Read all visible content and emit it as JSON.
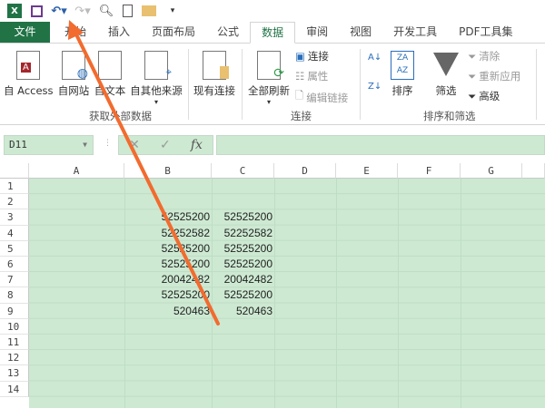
{
  "qat": {
    "icons": [
      "excel-icon",
      "save-icon",
      "undo-icon",
      "redo-icon",
      "print-preview-icon",
      "new-icon",
      "open-icon",
      "customize-icon"
    ]
  },
  "tabs": [
    "文件",
    "开始",
    "插入",
    "页面布局",
    "公式",
    "数据",
    "审阅",
    "视图",
    "开发工具",
    "PDF工具集"
  ],
  "active_tab": "数据",
  "ribbon": {
    "get_external": {
      "access": "自 Access",
      "web": "自网站",
      "text": "自文本",
      "other": "自其他来源",
      "existing": "现有连接",
      "label": "获取外部数据"
    },
    "connections": {
      "refresh_all": "全部刷新",
      "connections": "连接",
      "properties": "属性",
      "edit_links": "编辑链接",
      "label": "连接"
    },
    "sort_filter": {
      "sort": "排序",
      "filter": "筛选",
      "clear": "清除",
      "reapply": "重新应用",
      "advanced": "高级",
      "label": "排序和筛选"
    }
  },
  "formula_bar": {
    "name_box": "D11",
    "fx": "fx",
    "value": ""
  },
  "columns": [
    "A",
    "B",
    "C",
    "D",
    "E",
    "F",
    "G"
  ],
  "rows": [
    "1",
    "2",
    "3",
    "4",
    "5",
    "6",
    "7",
    "8",
    "9",
    "10",
    "11",
    "12",
    "13",
    "14"
  ],
  "cells": [
    {
      "row": 3,
      "B": "52525200",
      "C": "52525200"
    },
    {
      "row": 4,
      "B": "52252582",
      "C": "52252582"
    },
    {
      "row": 5,
      "B": "52525200",
      "C": "52525200"
    },
    {
      "row": 6,
      "B": "52525200",
      "C": "52525200"
    },
    {
      "row": 7,
      "B": "20042482",
      "C": "20042482"
    },
    {
      "row": 8,
      "B": "52525200",
      "C": "52525200"
    },
    {
      "row": 9,
      "B": "520463",
      "C": "520463"
    }
  ],
  "colors": {
    "accent": "#217346",
    "cell_bg": "#cde9d2",
    "arrow": "#f26b2f"
  }
}
